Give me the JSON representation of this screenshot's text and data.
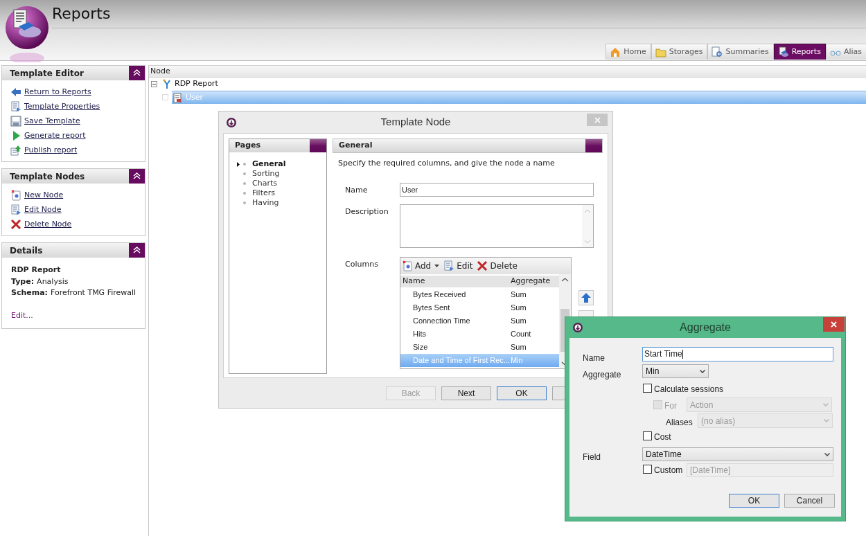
{
  "app": {
    "title": "Reports"
  },
  "nav_tabs": [
    {
      "label": "Home",
      "selected": false
    },
    {
      "label": "Storages",
      "selected": false
    },
    {
      "label": "Summaries",
      "selected": false
    },
    {
      "label": "Reports",
      "selected": true
    },
    {
      "label": "Alias",
      "selected": false
    }
  ],
  "sidebar_panels": [
    {
      "title": "Template Editor",
      "items": [
        "Return to Reports",
        "Template Properties",
        "Save Template",
        "Generate report",
        "Publish report"
      ]
    },
    {
      "title": "Template Nodes",
      "items": [
        "New Node",
        "Edit Node",
        "Delete Node"
      ]
    }
  ],
  "details": {
    "title": "Details",
    "name": "RDP Report",
    "fields": [
      {
        "label": "Type:",
        "value": "Analysis"
      },
      {
        "label": "Schema:",
        "value": "Forefront TMG Firewall"
      }
    ],
    "link": "Edit..."
  },
  "tree": {
    "column": "Node",
    "nodes": [
      {
        "label": "RDP Report",
        "expanded": true,
        "selected": false,
        "children": [
          {
            "label": "User",
            "selected": true
          }
        ]
      }
    ]
  },
  "template_dialog": {
    "title": "Template Node",
    "pages_title": "Pages",
    "pages": [
      {
        "label": "General",
        "selected": true
      },
      {
        "label": "Sorting",
        "selected": false
      },
      {
        "label": "Charts",
        "selected": false
      },
      {
        "label": "Filters",
        "selected": false
      },
      {
        "label": "Having",
        "selected": false
      }
    ],
    "section_title": "General",
    "hint": "Specify the required columns, and give the node a name",
    "name": {
      "label": "Name",
      "value": "User"
    },
    "description": {
      "label": "Description"
    },
    "columns": {
      "label": "Columns",
      "toolbar": [
        "Add",
        "Edit",
        "Delete"
      ],
      "headers": [
        "Name",
        "Aggregate"
      ],
      "rows": [
        {
          "name": "Bytes Received",
          "aggregate": "Sum",
          "selected": false
        },
        {
          "name": "Bytes Sent",
          "aggregate": "Sum",
          "selected": false
        },
        {
          "name": "Connection Time",
          "aggregate": "Sum",
          "selected": false
        },
        {
          "name": "Hits",
          "aggregate": "Count",
          "selected": false
        },
        {
          "name": "Size",
          "aggregate": "Sum",
          "selected": false
        },
        {
          "name": "Date and Time of First Rec...",
          "aggregate": "Min",
          "selected": true
        }
      ]
    },
    "buttons": [
      {
        "label": "Back",
        "disabled": true,
        "default": false
      },
      {
        "label": "Next",
        "disabled": false,
        "default": false
      },
      {
        "label": "OK",
        "disabled": false,
        "default": true
      }
    ]
  },
  "aggregate_dialog": {
    "title": "Aggregate",
    "name": {
      "label": "Name",
      "value": "Start Time"
    },
    "aggregate": {
      "label": "Aggregate",
      "value": "Min"
    },
    "calculate_sessions": {
      "label": "Calculate sessions",
      "checked": false
    },
    "for": {
      "label": "For",
      "checked": false,
      "disabled": true,
      "value": "Action"
    },
    "aliases": {
      "label": "Aliases",
      "value": "(no alias)",
      "disabled": true
    },
    "cost": {
      "label": "Cost",
      "checked": false
    },
    "field": {
      "label": "Field",
      "value": "DateTime"
    },
    "custom": {
      "label": "Custom",
      "checked": false,
      "placeholder": "[DateTime]",
      "disabled": true
    },
    "buttons": [
      {
        "label": "OK",
        "default": true
      },
      {
        "label": "Cancel",
        "default": false
      }
    ]
  }
}
